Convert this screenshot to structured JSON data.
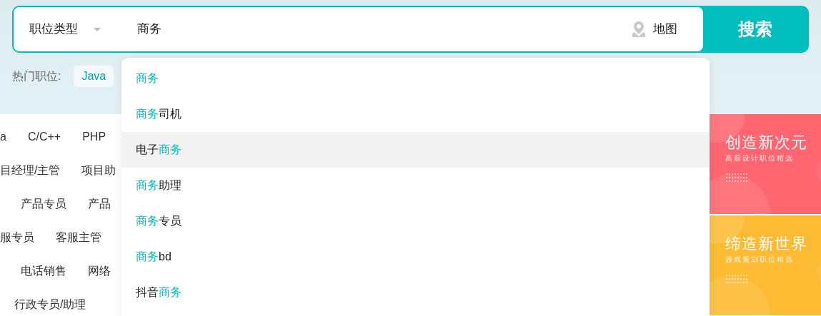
{
  "search": {
    "category_select": "职位类型",
    "query": "商务",
    "map_link": "地图",
    "button": "搜索"
  },
  "hot_jobs": {
    "label": "热门职位:",
    "tags": [
      "Java"
    ]
  },
  "category_rows": [
    [
      "a",
      "C/C++",
      "PHP"
    ],
    [
      "目经理/主管",
      "项目助"
    ],
    [
      "产品专员",
      "产品"
    ],
    [
      "服专员",
      "客服主管"
    ],
    [
      "电话销售",
      "网络"
    ],
    [
      "行政专员/助理"
    ]
  ],
  "suggestions": [
    {
      "selected": false,
      "parts": [
        {
          "text": "商务",
          "match": true
        }
      ]
    },
    {
      "selected": false,
      "parts": [
        {
          "text": "商务",
          "match": true
        },
        {
          "text": "司机",
          "match": false
        }
      ]
    },
    {
      "selected": true,
      "parts": [
        {
          "text": "电子",
          "match": false
        },
        {
          "text": "商务",
          "match": true
        }
      ]
    },
    {
      "selected": false,
      "parts": [
        {
          "text": "商务",
          "match": true
        },
        {
          "text": "助理",
          "match": false
        }
      ]
    },
    {
      "selected": false,
      "parts": [
        {
          "text": "商务",
          "match": true
        },
        {
          "text": "专员",
          "match": false
        }
      ]
    },
    {
      "selected": false,
      "parts": [
        {
          "text": "商务",
          "match": true
        },
        {
          "text": "bd",
          "match": false
        }
      ]
    },
    {
      "selected": false,
      "parts": [
        {
          "text": "抖音",
          "match": false
        },
        {
          "text": "商务",
          "match": true
        }
      ]
    }
  ],
  "banners": [
    {
      "title": "创造新次元",
      "subtitle": "高薪设计职位精选",
      "color": "#ff6670"
    },
    {
      "title": "缔造新世界",
      "subtitle": "游戏策划职位精选",
      "color": "#fdbb33"
    }
  ]
}
